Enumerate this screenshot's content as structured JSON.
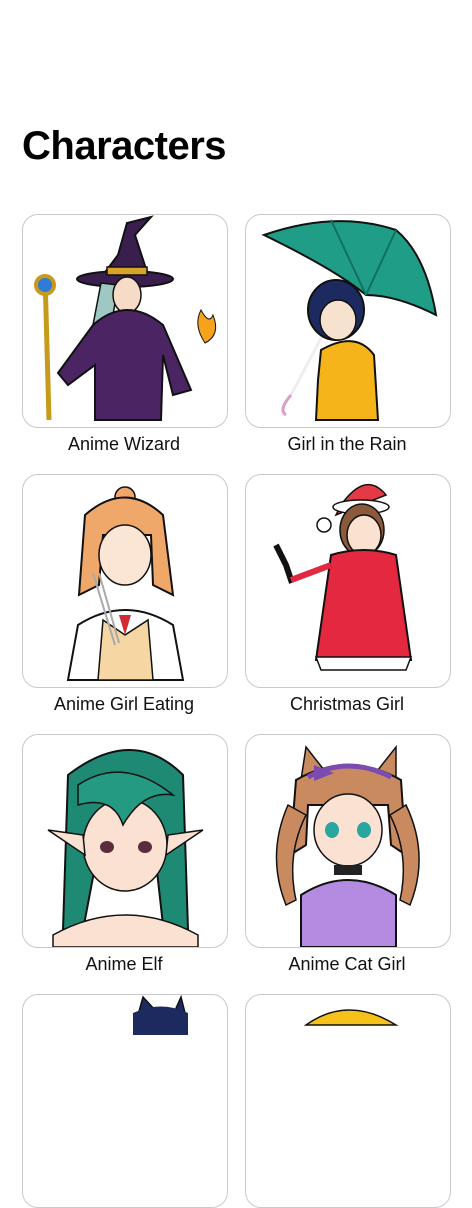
{
  "page": {
    "title": "Characters"
  },
  "characters": [
    {
      "name": "Anime Wizard"
    },
    {
      "name": "Girl in the Rain"
    },
    {
      "name": "Anime Girl Eating"
    },
    {
      "name": "Christmas Girl"
    },
    {
      "name": "Anime Elf"
    },
    {
      "name": "Anime Cat Girl"
    }
  ],
  "icons": [
    "wizard-illustration",
    "umbrella-girl-illustration",
    "eating-girl-illustration",
    "christmas-girl-illustration",
    "elf-illustration",
    "cat-girl-illustration",
    "cat-character-illustration",
    "yellow-hat-character-illustration"
  ]
}
